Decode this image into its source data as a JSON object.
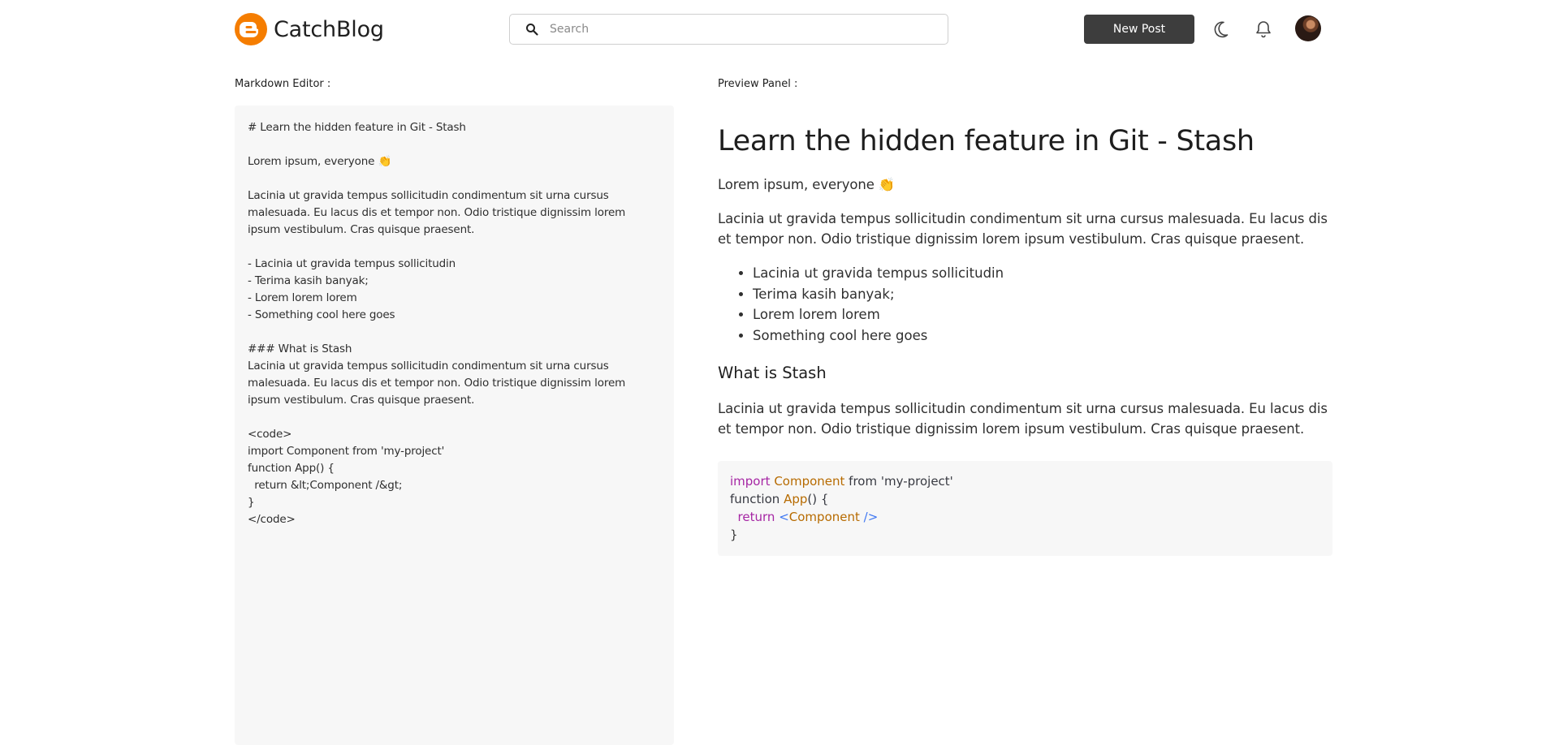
{
  "header": {
    "brand_name": "CatchBlog",
    "search_placeholder": "Search",
    "new_post_label": "New Post",
    "icons": [
      "blogger-logo-icon",
      "search-icon",
      "moon-icon",
      "bell-icon",
      "avatar"
    ],
    "brand_color": "#f57d00",
    "button_color": "#3d3d3d"
  },
  "editor": {
    "label": "Markdown Editor :",
    "content": "# Learn the hidden feature in Git - Stash\n\nLorem ipsum, everyone 👏\n\nLacinia ut gravida tempus sollicitudin condimentum sit urna cursus\nmalesuada. Eu lacus dis et tempor non. Odio tristique dignissim lorem\nipsum vestibulum. Cras quisque praesent.\n\n- Lacinia ut gravida tempus sollicitudin\n- Terima kasih banyak;\n- Lorem lorem lorem\n- Something cool here goes\n\n### What is Stash\nLacinia ut gravida tempus sollicitudin condimentum sit urna cursus\nmalesuada. Eu lacus dis et tempor non. Odio tristique dignissim lorem\nipsum vestibulum. Cras quisque praesent.\n\n<code>\nimport Component from 'my-project'\nfunction App() {\n  return &lt;Component /&gt;\n}\n</code>"
  },
  "preview": {
    "label": "Preview Panel :",
    "title": "Learn the hidden feature in Git - Stash",
    "greeting": "Lorem ipsum, everyone 👏",
    "paragraph1": "Lacinia ut gravida tempus sollicitudin condimentum sit urna cursus malesuada. Eu lacus dis et tempor non. Odio tristique dignissim lorem ipsum vestibulum. Cras quisque praesent.",
    "list": [
      "Lacinia ut gravida tempus sollicitudin",
      "Terima kasih banyak;",
      "Lorem lorem lorem",
      "Something cool here goes"
    ],
    "subheading": "What is Stash",
    "paragraph2": "Lacinia ut gravida tempus sollicitudin condimentum sit urna cursus malesuada. Eu lacus dis et tempor non. Odio tristique dignissim lorem ipsum vestibulum. Cras quisque praesent.",
    "code": {
      "line1": {
        "kw": "import",
        "name": "Component",
        "rest": " from 'my-project'"
      },
      "line2": {
        "kw": "function",
        "name": "App",
        "rest": "() {"
      },
      "line3": {
        "kw": "return",
        "open": "<",
        "name": "Component",
        "close": " />"
      },
      "line4": "}"
    }
  }
}
